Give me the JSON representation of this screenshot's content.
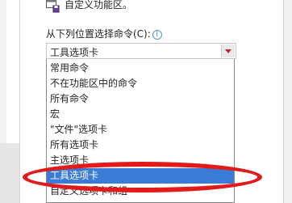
{
  "top_row": {
    "label": "自定义功能区。"
  },
  "choose_commands": {
    "label": "从下列位置选择命令(C):",
    "info_icon": "info-icon"
  },
  "combo": {
    "selected_value": "工具选项卡",
    "arrow_icon": "chevron-down-icon"
  },
  "dropdown": {
    "items": [
      {
        "label": "常用命令"
      },
      {
        "label": "不在功能区中的命令"
      },
      {
        "label": "所有命令"
      },
      {
        "label": "宏"
      },
      {
        "label": "\"文件\"选项卡"
      },
      {
        "label": "所有选项卡"
      },
      {
        "label": "主选项卡"
      },
      {
        "label": "工具选项卡",
        "selected": true
      },
      {
        "label": "自定义选项卡和组"
      }
    ]
  },
  "colors": {
    "selection": "#3a7bd5",
    "annotation_ring": "#e21a1a"
  }
}
